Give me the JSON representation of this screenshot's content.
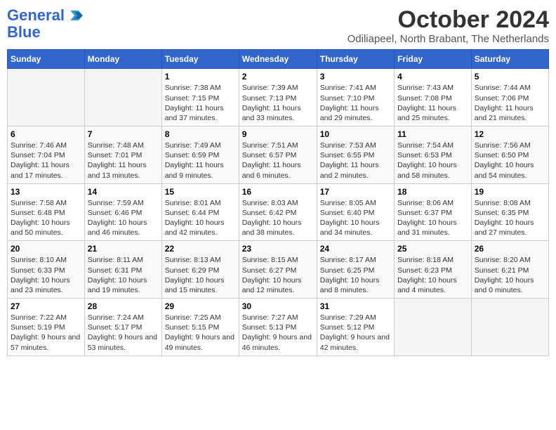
{
  "header": {
    "logo_general": "General",
    "logo_blue": "Blue",
    "month_title": "October 2024",
    "location": "Odiliapeel, North Brabant, The Netherlands"
  },
  "days_of_week": [
    "Sunday",
    "Monday",
    "Tuesday",
    "Wednesday",
    "Thursday",
    "Friday",
    "Saturday"
  ],
  "weeks": [
    [
      {
        "num": "",
        "info": ""
      },
      {
        "num": "",
        "info": ""
      },
      {
        "num": "1",
        "info": "Sunrise: 7:38 AM\nSunset: 7:15 PM\nDaylight: 11 hours and 37 minutes."
      },
      {
        "num": "2",
        "info": "Sunrise: 7:39 AM\nSunset: 7:13 PM\nDaylight: 11 hours and 33 minutes."
      },
      {
        "num": "3",
        "info": "Sunrise: 7:41 AM\nSunset: 7:10 PM\nDaylight: 11 hours and 29 minutes."
      },
      {
        "num": "4",
        "info": "Sunrise: 7:43 AM\nSunset: 7:08 PM\nDaylight: 11 hours and 25 minutes."
      },
      {
        "num": "5",
        "info": "Sunrise: 7:44 AM\nSunset: 7:06 PM\nDaylight: 11 hours and 21 minutes."
      }
    ],
    [
      {
        "num": "6",
        "info": "Sunrise: 7:46 AM\nSunset: 7:04 PM\nDaylight: 11 hours and 17 minutes."
      },
      {
        "num": "7",
        "info": "Sunrise: 7:48 AM\nSunset: 7:01 PM\nDaylight: 11 hours and 13 minutes."
      },
      {
        "num": "8",
        "info": "Sunrise: 7:49 AM\nSunset: 6:59 PM\nDaylight: 11 hours and 9 minutes."
      },
      {
        "num": "9",
        "info": "Sunrise: 7:51 AM\nSunset: 6:57 PM\nDaylight: 11 hours and 6 minutes."
      },
      {
        "num": "10",
        "info": "Sunrise: 7:53 AM\nSunset: 6:55 PM\nDaylight: 11 hours and 2 minutes."
      },
      {
        "num": "11",
        "info": "Sunrise: 7:54 AM\nSunset: 6:53 PM\nDaylight: 10 hours and 58 minutes."
      },
      {
        "num": "12",
        "info": "Sunrise: 7:56 AM\nSunset: 6:50 PM\nDaylight: 10 hours and 54 minutes."
      }
    ],
    [
      {
        "num": "13",
        "info": "Sunrise: 7:58 AM\nSunset: 6:48 PM\nDaylight: 10 hours and 50 minutes."
      },
      {
        "num": "14",
        "info": "Sunrise: 7:59 AM\nSunset: 6:46 PM\nDaylight: 10 hours and 46 minutes."
      },
      {
        "num": "15",
        "info": "Sunrise: 8:01 AM\nSunset: 6:44 PM\nDaylight: 10 hours and 42 minutes."
      },
      {
        "num": "16",
        "info": "Sunrise: 8:03 AM\nSunset: 6:42 PM\nDaylight: 10 hours and 38 minutes."
      },
      {
        "num": "17",
        "info": "Sunrise: 8:05 AM\nSunset: 6:40 PM\nDaylight: 10 hours and 34 minutes."
      },
      {
        "num": "18",
        "info": "Sunrise: 8:06 AM\nSunset: 6:37 PM\nDaylight: 10 hours and 31 minutes."
      },
      {
        "num": "19",
        "info": "Sunrise: 8:08 AM\nSunset: 6:35 PM\nDaylight: 10 hours and 27 minutes."
      }
    ],
    [
      {
        "num": "20",
        "info": "Sunrise: 8:10 AM\nSunset: 6:33 PM\nDaylight: 10 hours and 23 minutes."
      },
      {
        "num": "21",
        "info": "Sunrise: 8:11 AM\nSunset: 6:31 PM\nDaylight: 10 hours and 19 minutes."
      },
      {
        "num": "22",
        "info": "Sunrise: 8:13 AM\nSunset: 6:29 PM\nDaylight: 10 hours and 15 minutes."
      },
      {
        "num": "23",
        "info": "Sunrise: 8:15 AM\nSunset: 6:27 PM\nDaylight: 10 hours and 12 minutes."
      },
      {
        "num": "24",
        "info": "Sunrise: 8:17 AM\nSunset: 6:25 PM\nDaylight: 10 hours and 8 minutes."
      },
      {
        "num": "25",
        "info": "Sunrise: 8:18 AM\nSunset: 6:23 PM\nDaylight: 10 hours and 4 minutes."
      },
      {
        "num": "26",
        "info": "Sunrise: 8:20 AM\nSunset: 6:21 PM\nDaylight: 10 hours and 0 minutes."
      }
    ],
    [
      {
        "num": "27",
        "info": "Sunrise: 7:22 AM\nSunset: 5:19 PM\nDaylight: 9 hours and 57 minutes."
      },
      {
        "num": "28",
        "info": "Sunrise: 7:24 AM\nSunset: 5:17 PM\nDaylight: 9 hours and 53 minutes."
      },
      {
        "num": "29",
        "info": "Sunrise: 7:25 AM\nSunset: 5:15 PM\nDaylight: 9 hours and 49 minutes."
      },
      {
        "num": "30",
        "info": "Sunrise: 7:27 AM\nSunset: 5:13 PM\nDaylight: 9 hours and 46 minutes."
      },
      {
        "num": "31",
        "info": "Sunrise: 7:29 AM\nSunset: 5:12 PM\nDaylight: 9 hours and 42 minutes."
      },
      {
        "num": "",
        "info": ""
      },
      {
        "num": "",
        "info": ""
      }
    ]
  ]
}
